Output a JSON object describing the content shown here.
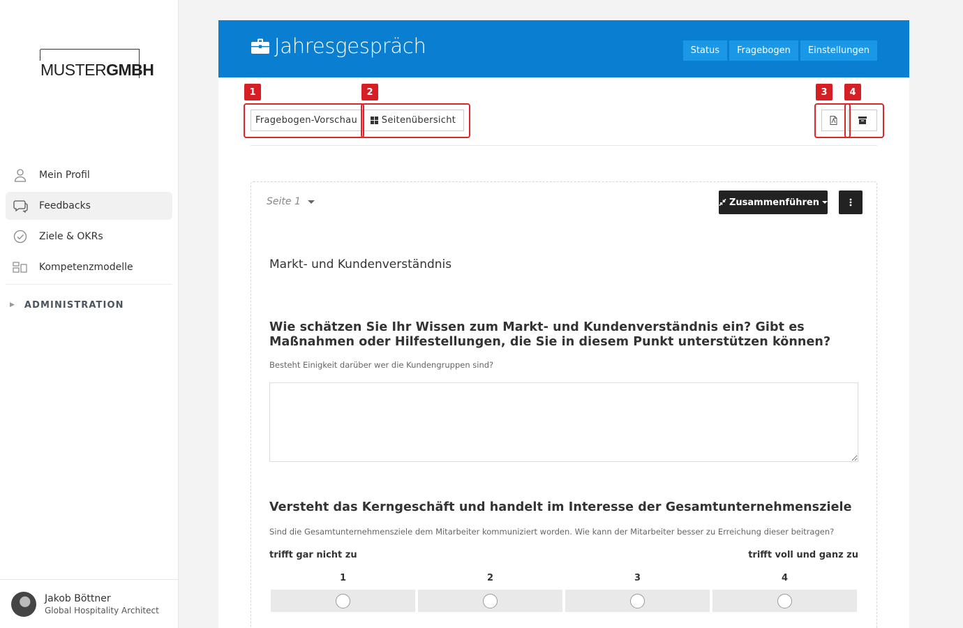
{
  "sidebar": {
    "logo": {
      "part1": "MUSTER",
      "part2": "GMBH"
    },
    "items": [
      {
        "label": "Mein Profil",
        "icon": "user-icon"
      },
      {
        "label": "Feedbacks",
        "icon": "chat-icon",
        "active": true
      },
      {
        "label": "Ziele & OKRs",
        "icon": "check-circle-icon"
      },
      {
        "label": "Kompetenzmodelle",
        "icon": "grid-icon"
      }
    ],
    "admin_label": "ADMINISTRATION",
    "user": {
      "name": "Jakob Böttner",
      "role": "Global Hospitality Architect"
    }
  },
  "header": {
    "title": "Jahresgespräch",
    "tabs": [
      "Status",
      "Fragebogen",
      "Einstellungen"
    ]
  },
  "toolbar": {
    "preview_label": "Fragebogen-Vorschau",
    "overview_label": "Seitenübersicht",
    "badges": [
      "1",
      "2",
      "3",
      "4"
    ]
  },
  "page": {
    "selector_label": "Seite 1",
    "merge_label": "Zusammenführen",
    "section_title": "Markt- und Kundenverständnis",
    "q1": {
      "title": "Wie schätzen Sie Ihr Wissen zum Markt- und Kundenverständnis ein? Gibt es Maßnahmen oder Hilfestellungen, die Sie in diesem Punkt unterstützen können?",
      "hint": "Besteht Einigkeit darüber wer die Kundengruppen sind?"
    },
    "q2": {
      "title": "Versteht das Kerngeschäft und handelt im Interesse der Gesamtunternehmensziele",
      "hint": "Sind die Gesamtunternehmensziele dem Mitarbeiter kommuniziert worden. Wie kann der Mitarbeiter besser zu Erreichung dieser beitragen?",
      "low_label": "trifft gar nicht zu",
      "high_label": "trifft voll und ganz zu",
      "scale": [
        "1",
        "2",
        "3",
        "4"
      ]
    }
  },
  "colors": {
    "header_blue": "#0a7ed1",
    "tab_blue": "#1a98e6",
    "annotation_red": "#e0242a"
  }
}
